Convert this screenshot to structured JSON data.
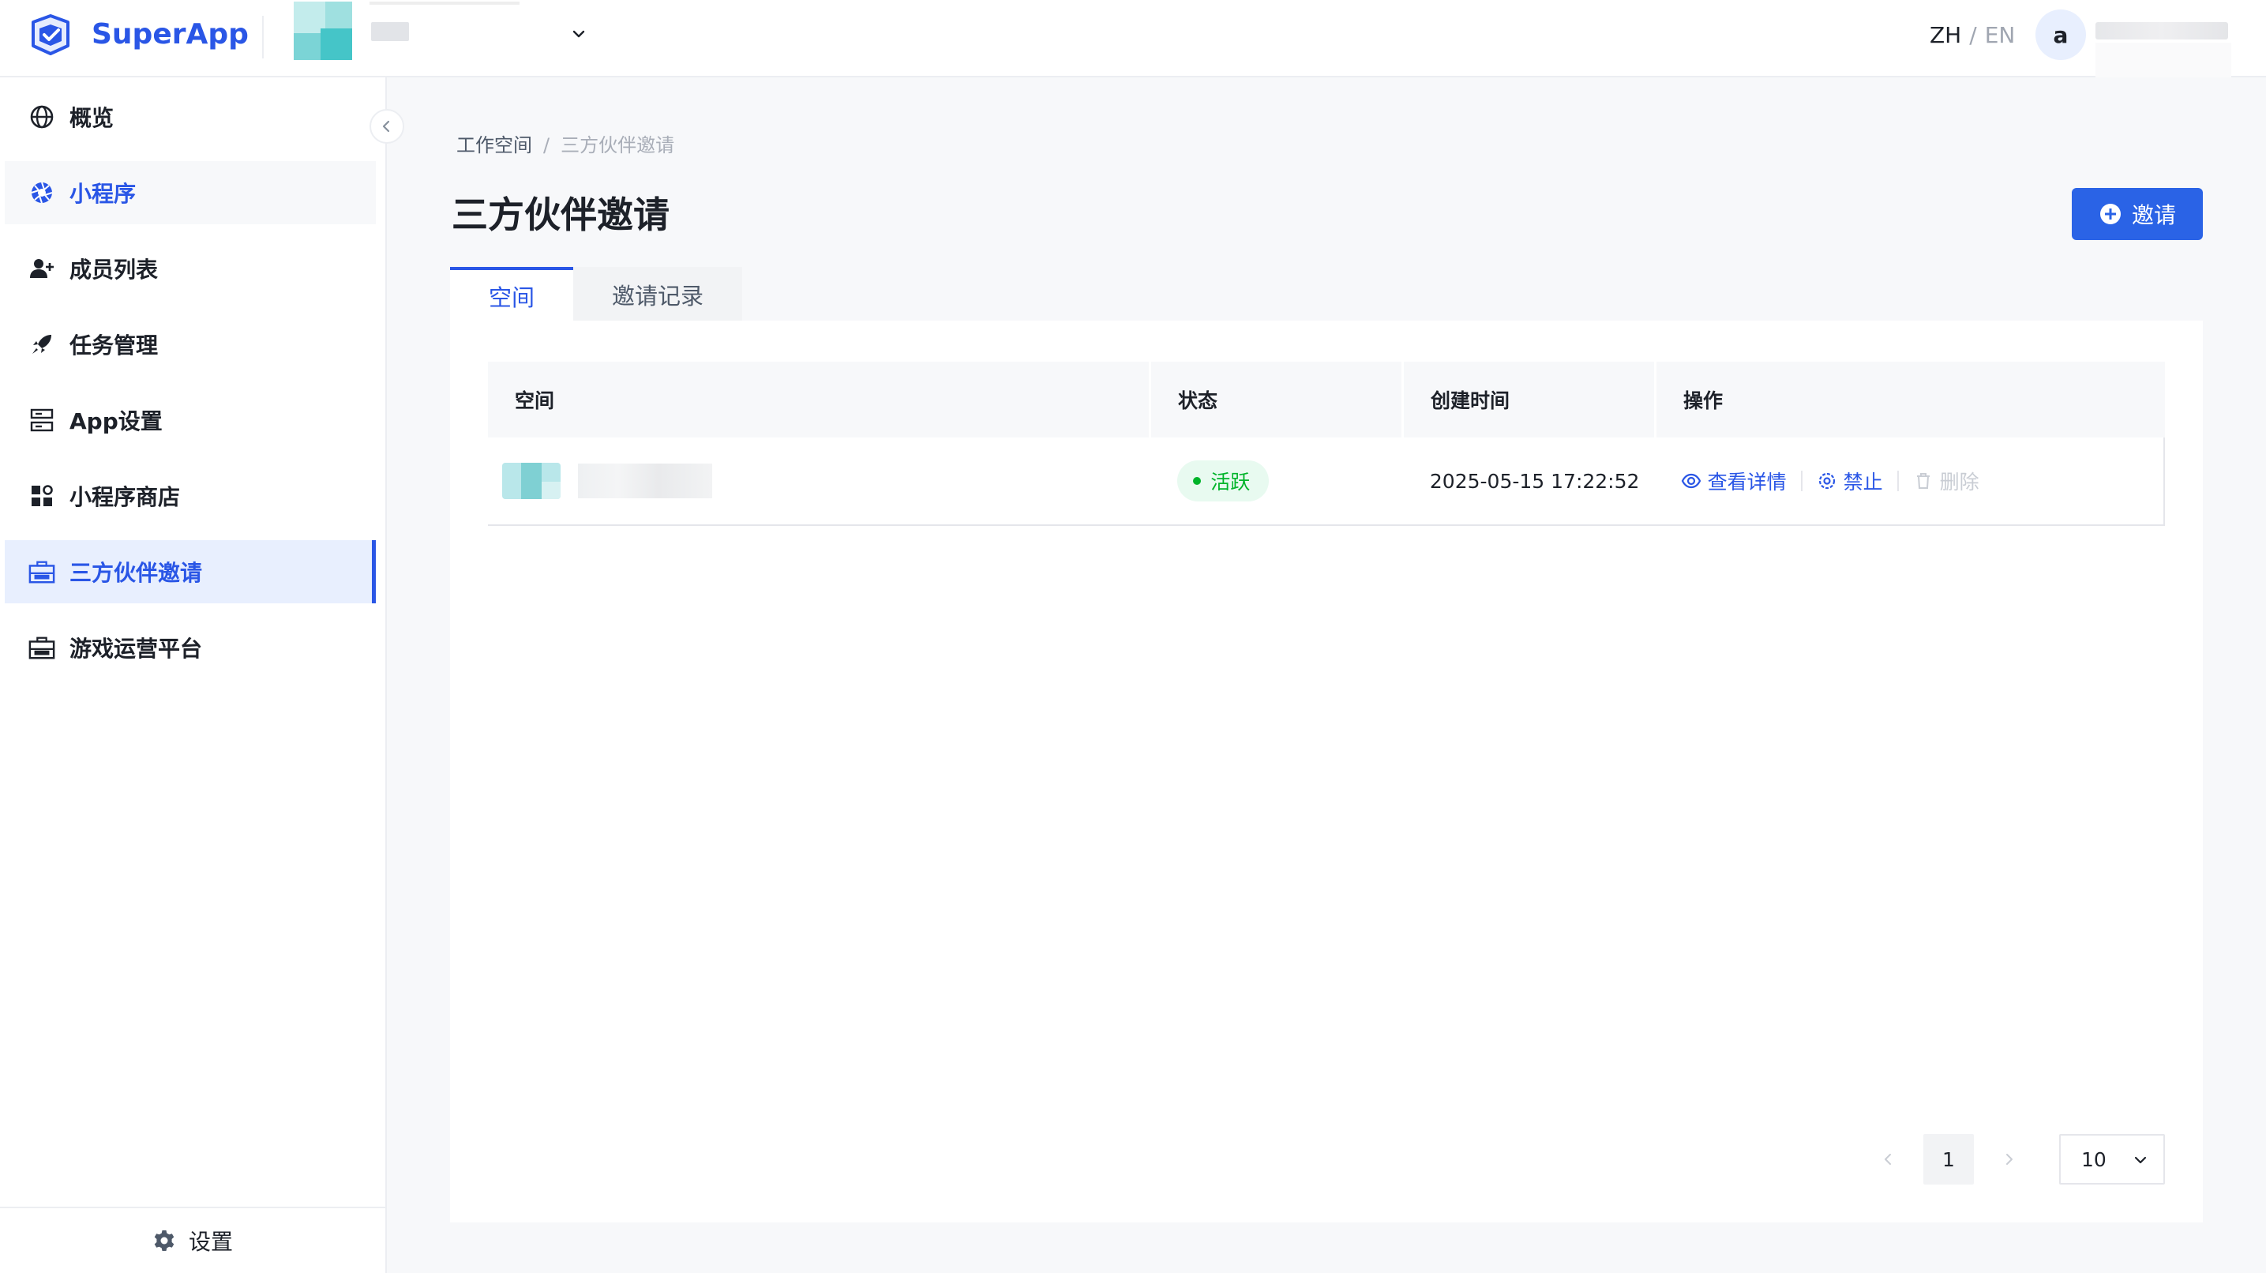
{
  "header": {
    "brand": "SuperApp",
    "language": {
      "zh": "ZH",
      "separator": "/",
      "en": "EN"
    },
    "user_initial": "a"
  },
  "sidebar": {
    "items": [
      {
        "label": "概览",
        "icon": "globe-icon"
      },
      {
        "label": "小程序",
        "icon": "aperture-icon"
      },
      {
        "label": "成员列表",
        "icon": "user-add-icon"
      },
      {
        "label": "任务管理",
        "icon": "rocket-icon"
      },
      {
        "label": "App设置",
        "icon": "server-icon"
      },
      {
        "label": "小程序商店",
        "icon": "apps-icon"
      },
      {
        "label": "三方伙伴邀请",
        "icon": "briefcase-icon"
      },
      {
        "label": "游戏运营平台",
        "icon": "briefcase-icon"
      }
    ],
    "footer_label": "设置"
  },
  "breadcrumb": {
    "root": "工作空间",
    "separator": "/",
    "current": "三方伙伴邀请"
  },
  "page": {
    "title": "三方伙伴邀请",
    "invite_button": "邀请"
  },
  "tabs": [
    {
      "label": "空间",
      "active": true
    },
    {
      "label": "邀请记录",
      "active": false
    }
  ],
  "table": {
    "columns": [
      "空间",
      "状态",
      "创建时间",
      "操作"
    ],
    "rows": [
      {
        "status": "活跃",
        "created_at": "2025-05-15 17:22:52",
        "actions": {
          "view": "查看详情",
          "ban": "禁止",
          "delete": "删除"
        }
      }
    ]
  },
  "pagination": {
    "current_page": "1",
    "page_size": "10"
  },
  "colors": {
    "primary": "#2a56e6",
    "success": "#00b42a",
    "active_bg": "#e8effe"
  }
}
